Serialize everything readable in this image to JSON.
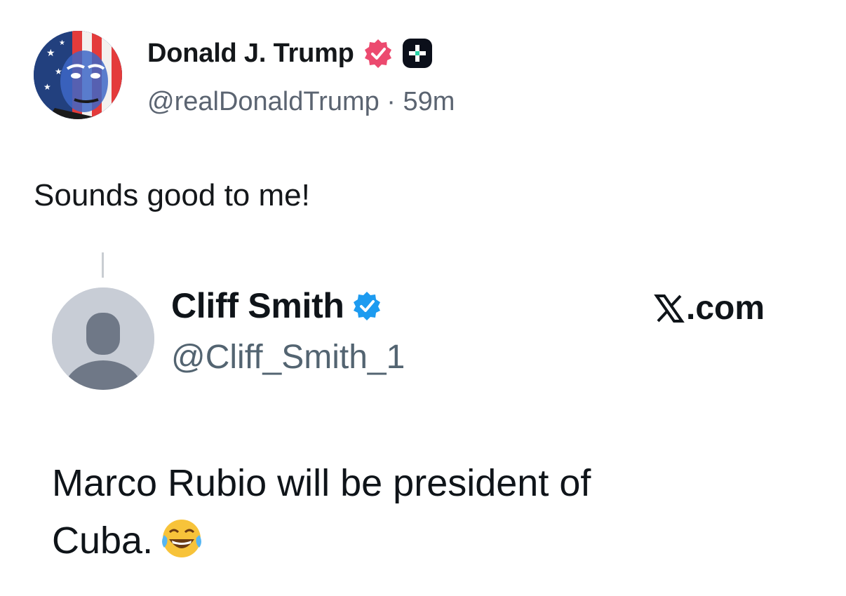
{
  "post": {
    "author": {
      "display_name": "Donald J. Trump",
      "handle": "@realDonaldTrump",
      "separator": " · ",
      "time": "59m",
      "verified_color": "#ec4a6f",
      "avatar_icon": "flag-portrait-avatar"
    },
    "text": "Sounds good to me!"
  },
  "quoted": {
    "author": {
      "display_name": "Cliff Smith",
      "handle": "@Cliff_Smith_1",
      "verified_color": "#1d9bf0",
      "avatar_icon": "default-profile-avatar"
    },
    "brand": ".com",
    "brand_icon": "x-logo-icon",
    "text_line1": "Marco Rubio will be president of",
    "text_line2": "Cuba.",
    "emoji": "face-with-tears-of-joy"
  }
}
